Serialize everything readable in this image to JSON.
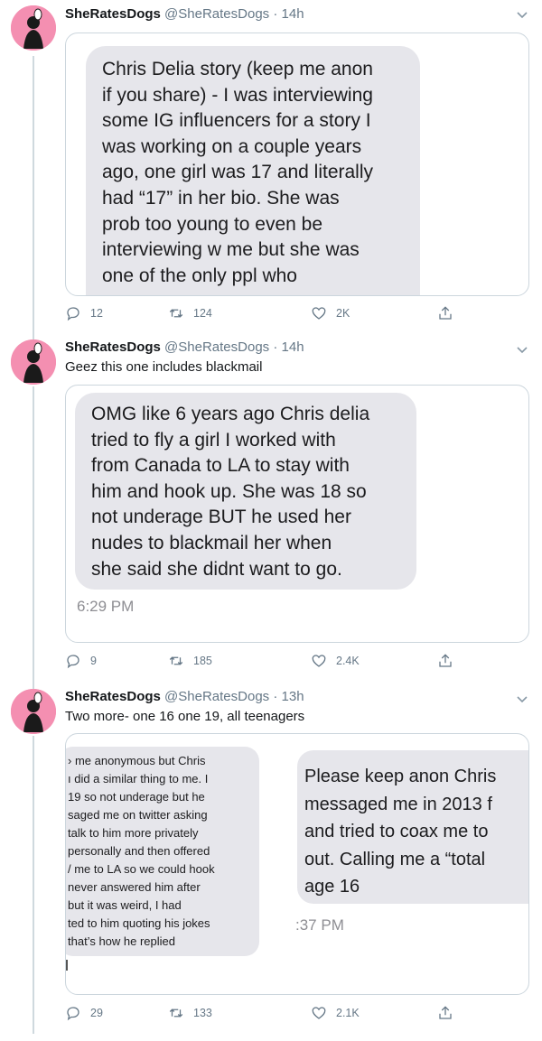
{
  "tweets": [
    {
      "display_name": "SheRatesDogs",
      "handle": "@SheRatesDogs",
      "time_ago": "14h",
      "text": "",
      "bubble_lines": [
        "Chris Delia story (keep me anon",
        "if you share) - I was interviewing",
        "some IG influencers for a story I",
        "was working on a couple years",
        "ago, one girl was 17 and literally",
        "had “17” in her bio. She was",
        "prob too young to even be",
        "interviewing w me but she was",
        "one of the only ppl who"
      ],
      "replies": "12",
      "retweets": "124",
      "likes": "2K"
    },
    {
      "display_name": "SheRatesDogs",
      "handle": "@SheRatesDogs",
      "time_ago": "14h",
      "text": "Geez this one includes blackmail",
      "bubble_lines": [
        "OMG like 6 years ago Chris delia",
        "tried to fly a girl I worked with",
        "from Canada to LA to stay with",
        "him and hook up. She was 18 so",
        "not underage BUT he used her",
        "nudes to blackmail her when",
        "she said she didnt want to go."
      ],
      "timestamp": "6:29 PM",
      "replies": "9",
      "retweets": "185",
      "likes": "2.4K"
    },
    {
      "display_name": "SheRatesDogs",
      "handle": "@SheRatesDogs",
      "time_ago": "13h",
      "text": "Two more- one 16 one 19, all teenagers",
      "left_bubble_lines": [
        "› me anonymous but Chris",
        "ı did a similar thing to me. I",
        "19 so not underage but he",
        "saged me on twitter asking",
        "talk to him more privately",
        "personally and then offered",
        "/ me to LA so we could hook",
        "never answered him after",
        "but it was weird, I had",
        "ted to him quoting his jokes",
        "that’s how he replied"
      ],
      "right_bubble_lines": [
        "Please keep anon Chris",
        "messaged me in 2013 f",
        "and tried to coax me to",
        "out. Calling me a “total",
        "age 16"
      ],
      "right_timestamp": ":37 PM",
      "replies": "29",
      "retweets": "133",
      "likes": "2.1K"
    }
  ],
  "separator": "·",
  "icons": {
    "reply": "reply-icon",
    "retweet": "retweet-icon",
    "like": "heart-icon",
    "share": "share-icon",
    "more": "chevron-down-icon"
  },
  "colors": {
    "avatar_bg": "#f48fb1",
    "bubble_bg": "#e6e6eb",
    "secondary_text": "#657786",
    "border": "#ccd6dd"
  }
}
